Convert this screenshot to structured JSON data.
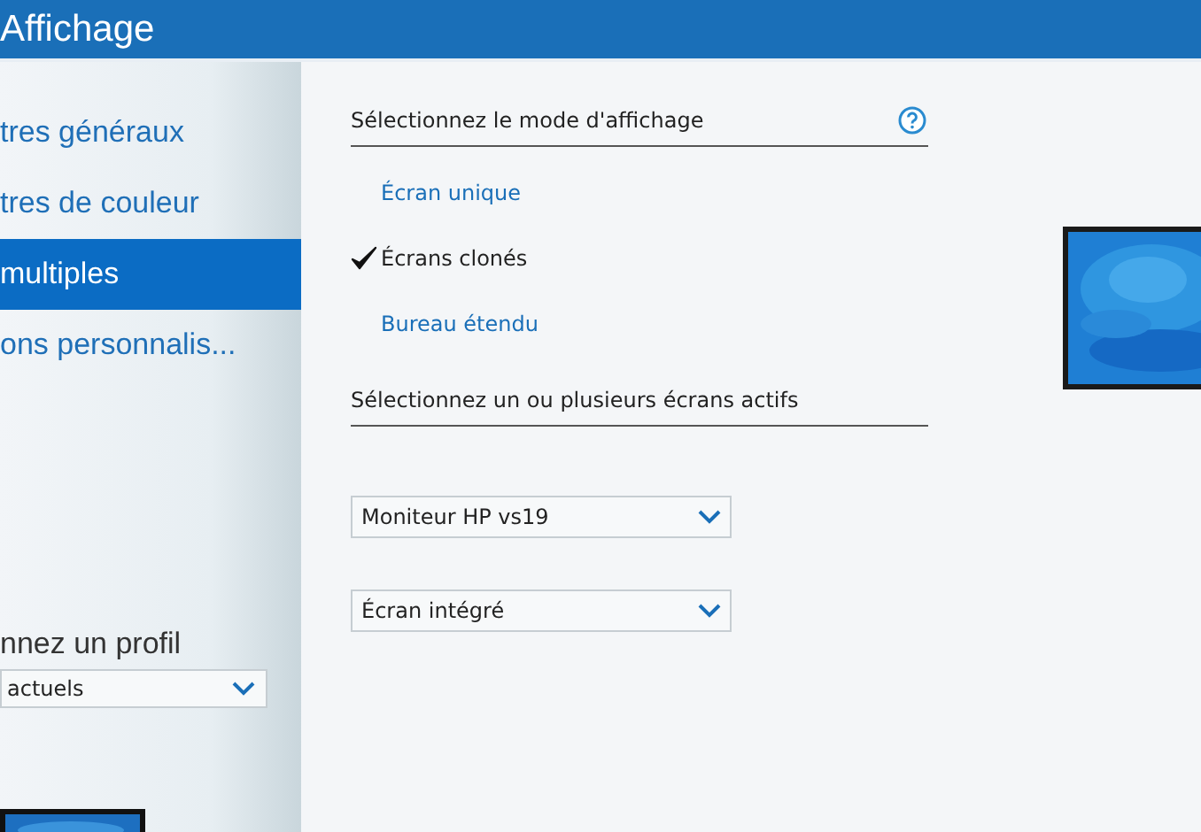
{
  "header": {
    "title": "Affichage"
  },
  "sidebar": {
    "items": [
      {
        "label": "tres généraux",
        "selected": false
      },
      {
        "label": "tres de couleur",
        "selected": false
      },
      {
        "label": "multiples",
        "selected": true
      },
      {
        "label": "ons personnalis...",
        "selected": false
      }
    ],
    "profile": {
      "label": "nnez un profil",
      "value": "actuels"
    }
  },
  "content": {
    "mode_heading": "Sélectionnez le mode d'affichage",
    "modes": [
      {
        "label": "Écran unique",
        "selected": false
      },
      {
        "label": "Écrans clonés",
        "selected": true
      },
      {
        "label": "Bureau étendu",
        "selected": false
      }
    ],
    "screens_heading": "Sélectionnez un ou plusieurs écrans actifs",
    "screens": [
      {
        "value": "Moniteur HP vs19"
      },
      {
        "value": "Écran intégré"
      }
    ]
  }
}
